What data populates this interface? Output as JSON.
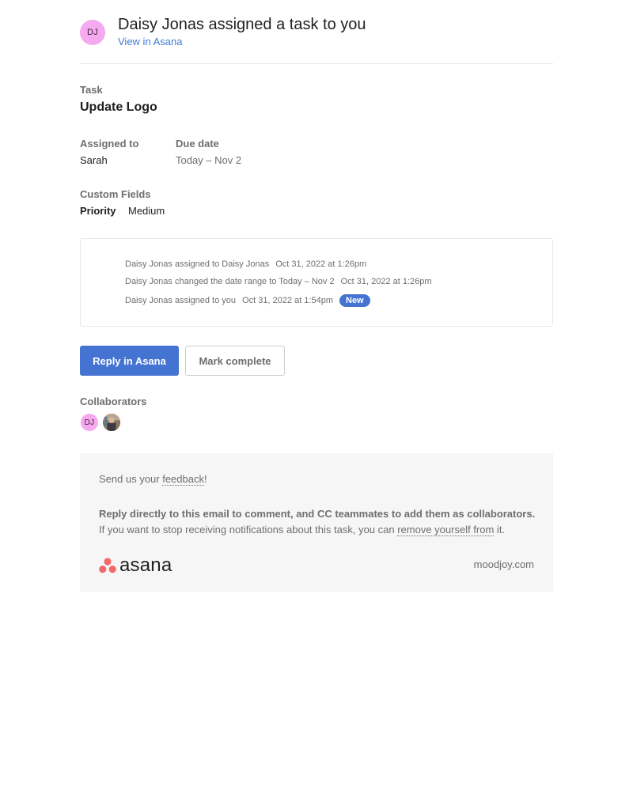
{
  "header": {
    "avatar_initials": "DJ",
    "title": "Daisy Jonas assigned a task to you",
    "link": "View in Asana"
  },
  "task": {
    "label": "Task",
    "name": "Update Logo"
  },
  "assignment": {
    "assigned_label": "Assigned to",
    "assigned_value": "Sarah",
    "due_label": "Due date",
    "due_value": "Today – Nov 2"
  },
  "custom_fields": {
    "label": "Custom Fields",
    "name": "Priority",
    "value": "Medium"
  },
  "activity": [
    {
      "text": "Daisy Jonas assigned to Daisy Jonas",
      "time": "Oct 31, 2022 at 1:26pm"
    },
    {
      "text": "Daisy Jonas changed the date range to Today – Nov 2",
      "time": "Oct 31, 2022 at 1:26pm"
    },
    {
      "text": "Daisy Jonas assigned to you",
      "time": "Oct 31, 2022 at 1:54pm",
      "badge": "New"
    }
  ],
  "buttons": {
    "reply": "Reply in Asana",
    "complete": "Mark complete"
  },
  "collaborators": {
    "label": "Collaborators",
    "first_initials": "DJ"
  },
  "footer": {
    "feedback_prefix": "Send us your ",
    "feedback_link": "feedback",
    "feedback_suffix": "!",
    "line1": "Reply directly to this email to comment, and CC teammates to add them as collaborators.",
    "line2_prefix": "If you want to stop receiving notifications about this task, you can ",
    "line2_link": "remove yourself from",
    "line2_suffix": " it.",
    "logo_text": "asana",
    "domain": "moodjoy.com"
  },
  "colors": {
    "accent": "#4573d2",
    "avatar": "#f5a9ee",
    "logo_dots": "#f06a6a"
  }
}
